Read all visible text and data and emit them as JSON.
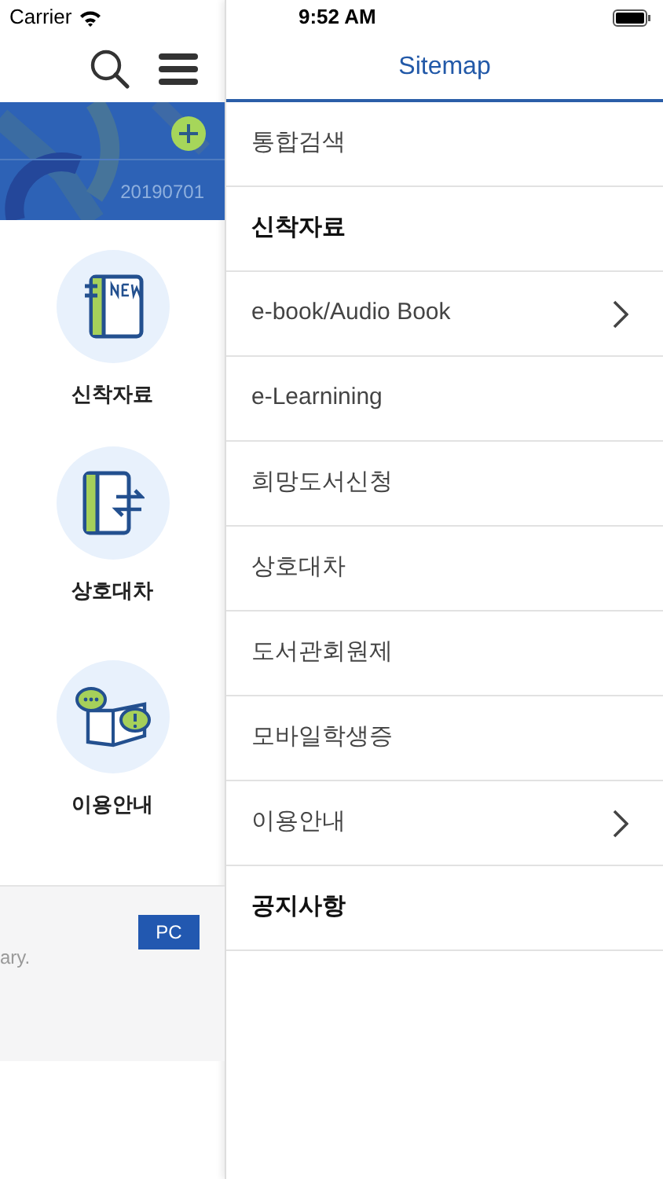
{
  "status_bar": {
    "carrier": "Carrier",
    "time": "9:52 AM"
  },
  "main": {
    "banner": {
      "date": "20190701"
    },
    "shortcuts": [
      {
        "kind": "new",
        "label": "신착자료"
      },
      {
        "kind": "exchange",
        "label": "상호대차"
      },
      {
        "kind": "guide",
        "label": "이용안내"
      }
    ],
    "footer": {
      "text": "ary.",
      "pc_button": "PC"
    }
  },
  "sitemap": {
    "title": "Sitemap",
    "items": [
      {
        "label": "통합검색",
        "bold": false,
        "has_submenu": false
      },
      {
        "label": "신착자료",
        "bold": true,
        "has_submenu": false
      },
      {
        "label": "e-book/Audio Book",
        "bold": false,
        "has_submenu": true
      },
      {
        "label": "e-Learnining",
        "bold": false,
        "has_submenu": false
      },
      {
        "label": "희망도서신청",
        "bold": false,
        "has_submenu": false
      },
      {
        "label": "상호대차",
        "bold": false,
        "has_submenu": false
      },
      {
        "label": "도서관회원제",
        "bold": false,
        "has_submenu": false
      },
      {
        "label": "모바일학생증",
        "bold": false,
        "has_submenu": false
      },
      {
        "label": "이용안내",
        "bold": false,
        "has_submenu": true
      },
      {
        "label": "공지사항",
        "bold": true,
        "has_submenu": false
      }
    ]
  }
}
